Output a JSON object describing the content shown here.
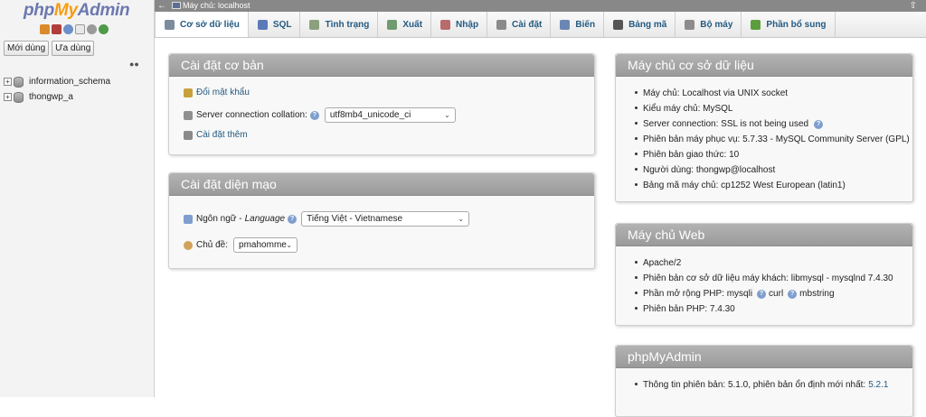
{
  "logo": {
    "php": "php",
    "my": "My",
    "admin": "Admin"
  },
  "left": {
    "tabs": [
      "Mới dùng",
      "Ưa dùng"
    ],
    "databases": [
      "information_schema",
      "thongwp_a"
    ]
  },
  "serverbar": {
    "label": "Máy chủ: localhost"
  },
  "menu": [
    {
      "label": "Cơ sở dữ liệu",
      "icon": "database-icon",
      "color": "#7b8c9c"
    },
    {
      "label": "SQL",
      "icon": "sql-icon",
      "color": "#5b7ab8"
    },
    {
      "label": "Tình trạng",
      "icon": "status-icon",
      "color": "#8ba07c"
    },
    {
      "label": "Xuất",
      "icon": "export-icon",
      "color": "#6f9c6f"
    },
    {
      "label": "Nhập",
      "icon": "import-icon",
      "color": "#b96b6b"
    },
    {
      "label": "Cài đặt",
      "icon": "wrench-icon",
      "color": "#8a8a8a"
    },
    {
      "label": "Biến",
      "icon": "variables-icon",
      "color": "#6a86b3"
    },
    {
      "label": "Bảng mã",
      "icon": "charset-icon",
      "color": "#555555"
    },
    {
      "label": "Bộ máy",
      "icon": "engine-icon",
      "color": "#8c8c8c"
    },
    {
      "label": "Phần bổ sung",
      "icon": "plugin-icon",
      "color": "#5c9e3b"
    }
  ],
  "general": {
    "title": "Cài đặt cơ bản",
    "change_password": "Đổi mật khẩu",
    "collation_label": "Server connection collation:",
    "collation_value": "utf8mb4_unicode_ci",
    "more_settings": "Cài đặt thêm"
  },
  "appearance": {
    "title": "Cài đặt diện mạo",
    "language_label": "Ngôn ngữ - ",
    "language_label_italic": "Language",
    "language_value": "Tiếng Việt - Vietnamese",
    "theme_label": "Chủ đề:",
    "theme_value": "pmahomme"
  },
  "db_server": {
    "title": "Máy chủ cơ sở dữ liệu",
    "items": [
      "Máy chủ: Localhost via UNIX socket",
      "Kiểu máy chủ: MySQL",
      "Server connection: SSL is not being used",
      "Phiên bản máy phục vụ: 5.7.33 - MySQL Community Server (GPL)",
      "Phiên bản giao thức: 10",
      "Người dùng: thongwp@localhost",
      "Bảng mã máy chủ: cp1252 West European (latin1)"
    ]
  },
  "web_server": {
    "title": "Máy chủ Web",
    "apache": "Apache/2",
    "client_version": "Phiên bản cơ sở dữ liệu máy khách: libmysql - mysqlnd 7.4.30",
    "php_ext_label": "Phần mở rộng PHP: mysqli",
    "php_ext_curl": "curl",
    "php_ext_mbstring": "mbstring",
    "php_version": "Phiên bản PHP: 7.4.30"
  },
  "pma": {
    "title": "phpMyAdmin",
    "version_text": "Thông tin phiên bản: 5.1.0, phiên bản ổn định mới nhất: ",
    "latest": "5.2.1"
  }
}
